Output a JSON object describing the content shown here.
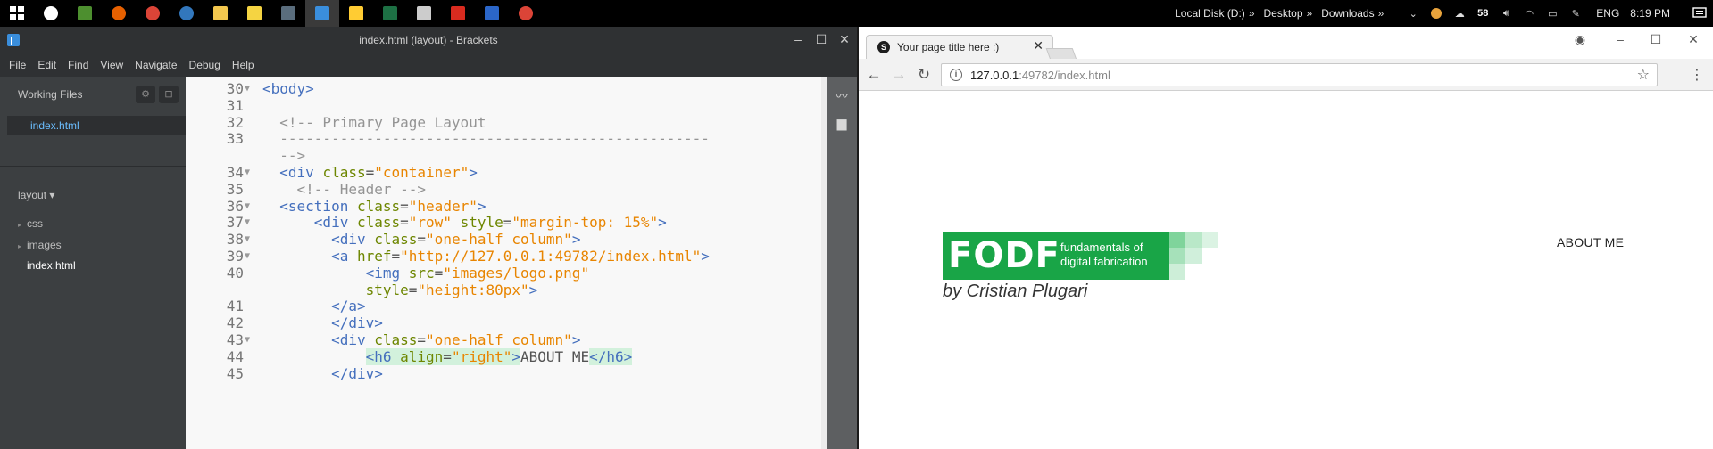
{
  "taskbar": {
    "apps": [
      {
        "name": "start-button",
        "color": "#ffffff"
      },
      {
        "name": "alarm-clock-icon",
        "color": "#ffffff"
      },
      {
        "name": "minecraft-icon",
        "color": "#4d8f2f"
      },
      {
        "name": "firefox-icon",
        "color": "#e66000"
      },
      {
        "name": "chrome-icon",
        "color": "#db4437"
      },
      {
        "name": "edge-icon",
        "color": "#3277bc"
      },
      {
        "name": "file-explorer-icon",
        "color": "#f3c74e"
      },
      {
        "name": "sticky-notes-icon",
        "color": "#f5d442"
      },
      {
        "name": "terminal-app-icon",
        "color": "#5a6d7d"
      },
      {
        "name": "brackets-icon",
        "color": "#3a8edc"
      },
      {
        "name": "media-app-icon",
        "color": "#ffcc33"
      },
      {
        "name": "excel-icon",
        "color": "#1d7044"
      },
      {
        "name": "3d-app-icon",
        "color": "#cccccc"
      },
      {
        "name": "pdf-reader-icon",
        "color": "#d92b1f"
      },
      {
        "name": "photoshop-icon",
        "color": "#2b66c8"
      },
      {
        "name": "chrome-icon-2",
        "color": "#db4437"
      }
    ],
    "toolbars": [
      "Local Disk (D:)",
      "Desktop",
      "Downloads"
    ],
    "badge": "58",
    "language": "ENG",
    "clock": "8:19 PM"
  },
  "brackets": {
    "title": "index.html (layout) - Brackets",
    "menu": [
      "File",
      "Edit",
      "Find",
      "View",
      "Navigate",
      "Debug",
      "Help"
    ],
    "working_files_title": "Working Files",
    "working_file": "index.html",
    "project": "layout ▾",
    "tree": [
      {
        "label": "css",
        "folder": true
      },
      {
        "label": "images",
        "folder": true
      },
      {
        "label": "index.html",
        "folder": false
      }
    ],
    "code_lines": [
      {
        "ln": "30",
        "fold": "▼",
        "segs": [
          {
            "t": "tag",
            "v": "<body>"
          }
        ]
      },
      {
        "ln": "31",
        "fold": "",
        "segs": []
      },
      {
        "ln": "32",
        "fold": "",
        "segs": [
          {
            "t": "cmt",
            "v": "  <!-- Primary Page Layout"
          }
        ]
      },
      {
        "ln": "33",
        "fold": "",
        "segs": [
          {
            "t": "cmt",
            "v": "  --------------------------------------------------"
          }
        ]
      },
      {
        "ln": "",
        "fold": "",
        "segs": [
          {
            "t": "cmt",
            "v": "  -->"
          }
        ]
      },
      {
        "ln": "34",
        "fold": "▼",
        "segs": [
          {
            "t": "tag",
            "v": "  <div "
          },
          {
            "t": "attr",
            "v": "class"
          },
          {
            "t": "txt",
            "v": "="
          },
          {
            "t": "str",
            "v": "\"container\""
          },
          {
            "t": "tag",
            "v": ">"
          }
        ]
      },
      {
        "ln": "35",
        "fold": "",
        "segs": [
          {
            "t": "cmt",
            "v": "    <!-- Header -->"
          }
        ]
      },
      {
        "ln": "36",
        "fold": "▼",
        "segs": [
          {
            "t": "tag",
            "v": "  <section "
          },
          {
            "t": "attr",
            "v": "class"
          },
          {
            "t": "txt",
            "v": "="
          },
          {
            "t": "str",
            "v": "\"header\""
          },
          {
            "t": "tag",
            "v": ">"
          }
        ]
      },
      {
        "ln": "37",
        "fold": "▼",
        "segs": [
          {
            "t": "tag",
            "v": "      <div "
          },
          {
            "t": "attr",
            "v": "class"
          },
          {
            "t": "txt",
            "v": "="
          },
          {
            "t": "str",
            "v": "\"row\""
          },
          {
            "t": "txt",
            "v": " "
          },
          {
            "t": "attr",
            "v": "style"
          },
          {
            "t": "txt",
            "v": "="
          },
          {
            "t": "str",
            "v": "\"margin-top: 15%\""
          },
          {
            "t": "tag",
            "v": ">"
          }
        ]
      },
      {
        "ln": "38",
        "fold": "▼",
        "segs": [
          {
            "t": "tag",
            "v": "        <div "
          },
          {
            "t": "attr",
            "v": "class"
          },
          {
            "t": "txt",
            "v": "="
          },
          {
            "t": "str",
            "v": "\"one-half column\""
          },
          {
            "t": "tag",
            "v": ">"
          }
        ]
      },
      {
        "ln": "39",
        "fold": "▼",
        "segs": [
          {
            "t": "tag",
            "v": "        <a "
          },
          {
            "t": "attr",
            "v": "href"
          },
          {
            "t": "txt",
            "v": "="
          },
          {
            "t": "str",
            "v": "\"http://127.0.0.1:49782/index.html\""
          },
          {
            "t": "tag",
            "v": ">"
          }
        ]
      },
      {
        "ln": "40",
        "fold": "",
        "segs": [
          {
            "t": "tag",
            "v": "            <img "
          },
          {
            "t": "attr",
            "v": "src"
          },
          {
            "t": "txt",
            "v": "="
          },
          {
            "t": "str",
            "v": "\"images/logo.png\""
          }
        ]
      },
      {
        "ln": "",
        "fold": "",
        "segs": [
          {
            "t": "attr",
            "v": "            style"
          },
          {
            "t": "txt",
            "v": "="
          },
          {
            "t": "str",
            "v": "\"height:80px\""
          },
          {
            "t": "tag",
            "v": ">"
          }
        ]
      },
      {
        "ln": "41",
        "fold": "",
        "segs": [
          {
            "t": "tag",
            "v": "        </a>"
          }
        ]
      },
      {
        "ln": "42",
        "fold": "",
        "segs": [
          {
            "t": "tag",
            "v": "        </div>"
          }
        ]
      },
      {
        "ln": "43",
        "fold": "▼",
        "segs": [
          {
            "t": "tag",
            "v": "        <div "
          },
          {
            "t": "attr",
            "v": "class"
          },
          {
            "t": "txt",
            "v": "="
          },
          {
            "t": "str",
            "v": "\"one-half column\""
          },
          {
            "t": "tag",
            "v": ">"
          }
        ]
      },
      {
        "ln": "44",
        "fold": "",
        "segs": [
          {
            "t": "txt",
            "v": "            "
          },
          {
            "t": "tag",
            "v": "<h6 ",
            "hl": true
          },
          {
            "t": "attr",
            "v": "align",
            "hl": true
          },
          {
            "t": "txt",
            "v": "=",
            "hl": true
          },
          {
            "t": "str",
            "v": "\"right\"",
            "hl": true
          },
          {
            "t": "tag",
            "v": ">",
            "hl": true
          },
          {
            "t": "txt",
            "v": "ABOUT ME"
          },
          {
            "t": "tag",
            "v": "</h6>",
            "hl": true
          }
        ]
      },
      {
        "ln": "45",
        "fold": "",
        "segs": [
          {
            "t": "tag",
            "v": "        </div>"
          }
        ]
      }
    ]
  },
  "chrome": {
    "tab_favicon": "S",
    "tab_title": "Your page title here :)",
    "url_host": "127.0.0.1",
    "url_rest": ":49782/index.html",
    "page": {
      "logo_text": "FODF",
      "logo_sub1": "fundamentals of",
      "logo_sub2": "digital fabrication",
      "byline": "by Cristian Plugari",
      "nav_link": "ABOUT ME"
    },
    "brand_green": "#19a547"
  }
}
